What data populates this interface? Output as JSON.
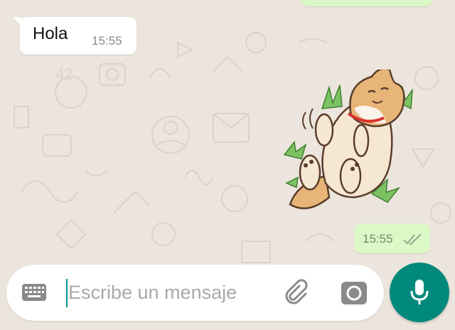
{
  "chat": {
    "incoming": {
      "text": "Hola",
      "time": "15:55"
    },
    "sticker": {
      "icon": "shiba-dog-sticker"
    },
    "outgoing": {
      "time": "15:55",
      "status_icon": "double-check-icon"
    }
  },
  "composer": {
    "placeholder": "Escribe un mensaje",
    "keyboard_icon": "keyboard-icon",
    "attach_icon": "paperclip-icon",
    "camera_icon": "camera-icon"
  },
  "mic": {
    "icon": "mic-icon"
  },
  "colors": {
    "wallpaper": "#ece5dd",
    "incoming_bubble": "#ffffff",
    "outgoing_bubble": "#dcf8c6",
    "accent": "#00897b",
    "caret": "#009688"
  }
}
